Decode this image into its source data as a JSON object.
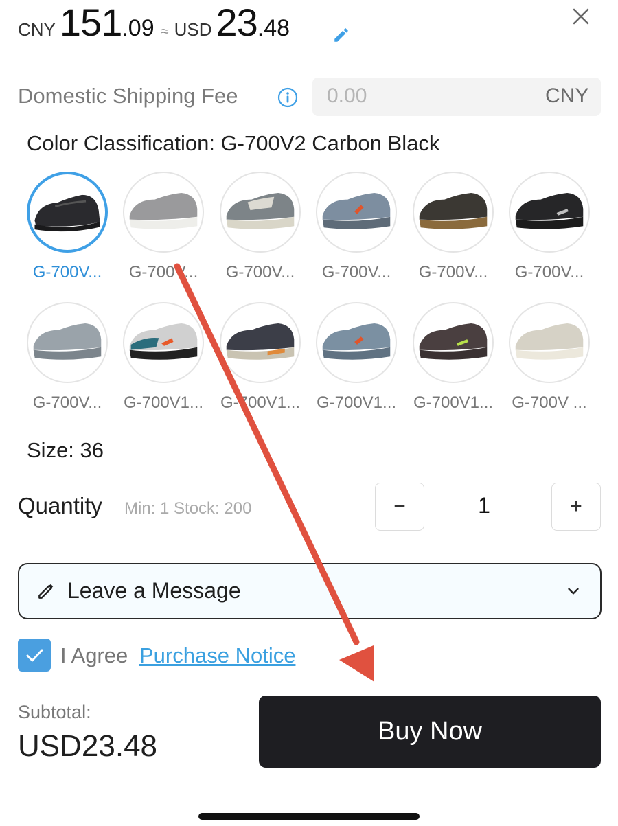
{
  "price": {
    "cny_label": "CNY",
    "cny_int": "151",
    "cny_dec": ".09",
    "approx": "≈",
    "usd_label": "USD",
    "usd_int": "23",
    "usd_dec": ".48"
  },
  "shipping": {
    "label": "Domestic Shipping Fee",
    "value": "0.00",
    "currency": "CNY"
  },
  "color": {
    "title": "Color Classification: G-700V2 Carbon Black",
    "swatches": [
      {
        "label": "G-700V...",
        "selected": true
      },
      {
        "label": "G-700V..."
      },
      {
        "label": "G-700V..."
      },
      {
        "label": "G-700V..."
      },
      {
        "label": "G-700V..."
      },
      {
        "label": "G-700V..."
      },
      {
        "label": "G-700V..."
      },
      {
        "label": "G-700V1..."
      },
      {
        "label": "G-700V1..."
      },
      {
        "label": "G-700V1..."
      },
      {
        "label": "G-700V1..."
      },
      {
        "label": "G-700V ..."
      }
    ]
  },
  "size": {
    "label": "Size: 36"
  },
  "quantity": {
    "label": "Quantity",
    "hint": "Min: 1   Stock: 200",
    "minus": "−",
    "value": "1",
    "plus": "+"
  },
  "message": {
    "label": "Leave a Message"
  },
  "agree": {
    "text": "I Agree",
    "link": "Purchase Notice",
    "checked": true
  },
  "subtotal": {
    "label": "Subtotal:",
    "value": "USD23.48"
  },
  "buy_button": {
    "label": "Buy Now"
  },
  "colors": {
    "accent": "#3fa0e6",
    "button_bg": "#1e1e22",
    "annotation_arrow": "#e0513f"
  }
}
